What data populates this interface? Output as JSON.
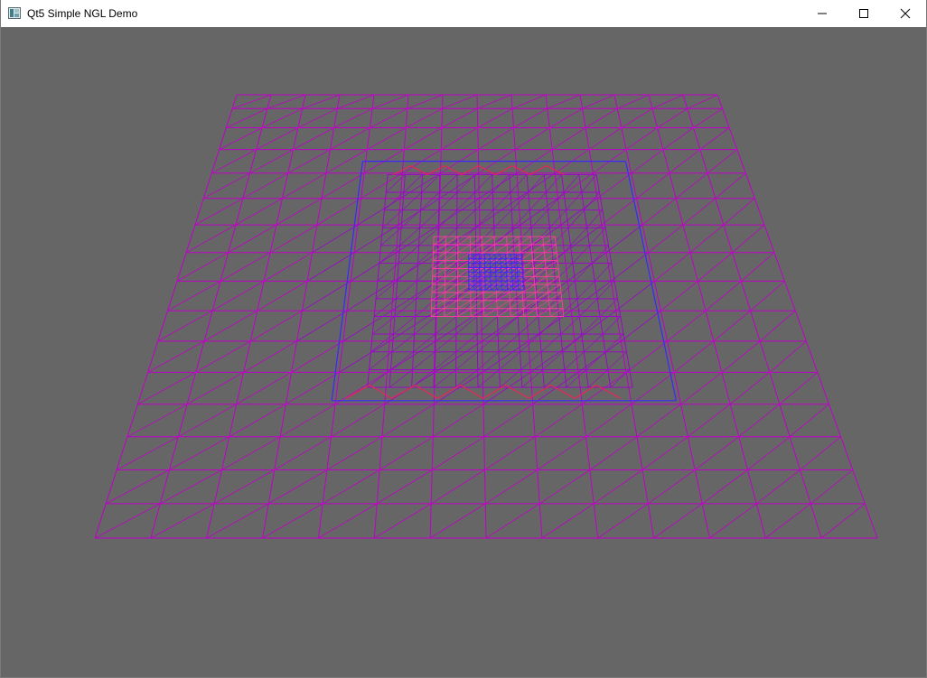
{
  "window": {
    "title": "Qt5 Simple NGL Demo",
    "app_icon": "qt-app-icon",
    "controls": {
      "minimize_icon": "minimize-icon",
      "maximize_icon": "maximize-icon",
      "close_icon": "close-icon"
    }
  },
  "viewport": {
    "background_color": "#666666",
    "scene": "wireframe-terrain-mesh",
    "colors": {
      "grid_primary": "#c000c8",
      "grid_secondary": "#a000d0",
      "accent_blue": "#3c28ff",
      "accent_red": "#e0285a",
      "accent_pink": "#ff3ca0"
    }
  }
}
